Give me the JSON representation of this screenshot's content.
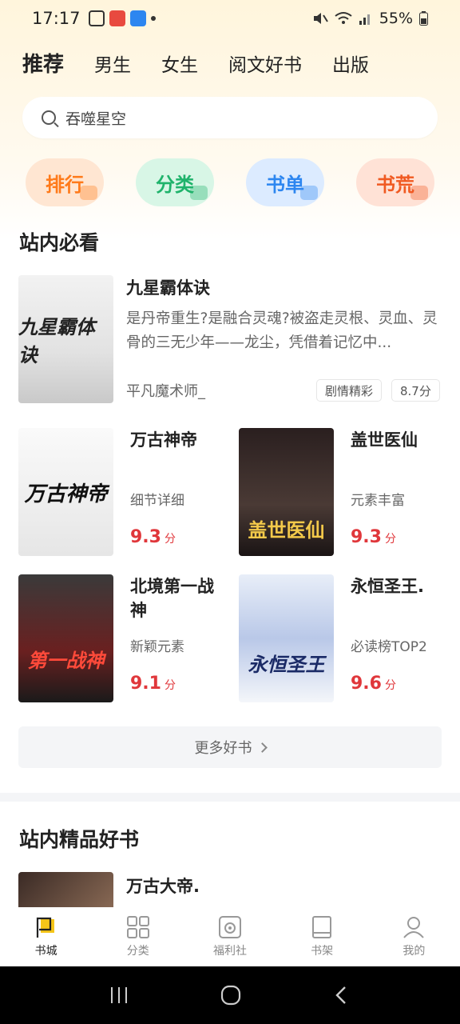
{
  "status_bar": {
    "time": "17:17",
    "battery": "55%"
  },
  "tabs": [
    {
      "label": "推荐",
      "active": true
    },
    {
      "label": "男生"
    },
    {
      "label": "女生"
    },
    {
      "label": "阅文好书"
    },
    {
      "label": "出版"
    }
  ],
  "search": {
    "placeholder": "吞噬星空"
  },
  "quick_buttons": [
    {
      "label": "排行",
      "bg": "#ffe6d2",
      "color": "#ff7a1a"
    },
    {
      "label": "分类",
      "bg": "#d8f6e6",
      "color": "#1fb36b"
    },
    {
      "label": "书单",
      "bg": "#dcebff",
      "color": "#2d86f0"
    },
    {
      "label": "书荒",
      "bg": "#ffe2d6",
      "color": "#f05a22"
    }
  ],
  "section1": {
    "title": "站内必看",
    "featured": {
      "name": "九星霸体诀",
      "cover_text": "九星霸体诀",
      "description": "是丹帝重生?是融合灵魂?被盗走灵根、灵血、灵骨的三无少年——龙尘，凭借着记忆中...",
      "author": "平凡魔术师_",
      "tag": "剧情精彩",
      "score": "8.7分"
    },
    "grid": [
      {
        "name": "万古神帝",
        "cover_text": "万古神帝",
        "sub": "细节详细",
        "score": "9.3",
        "unit": "分"
      },
      {
        "name": "盖世医仙",
        "cover_text": "盖世医仙",
        "sub": "元素丰富",
        "score": "9.3",
        "unit": "分"
      },
      {
        "name": "北境第一战神",
        "cover_text": "第一战神",
        "sub": "新颖元素",
        "score": "9.1",
        "unit": "分"
      },
      {
        "name": "永恒圣王.",
        "cover_text": "永恒圣王",
        "sub": "必读榜TOP2",
        "score": "9.6",
        "unit": "分"
      }
    ],
    "more": "更多好书"
  },
  "section2": {
    "title": "站内精品好书",
    "first_book": "万古大帝."
  },
  "bottom_nav": [
    {
      "label": "书城",
      "icon": "flag-icon",
      "active": true
    },
    {
      "label": "分类",
      "icon": "grid-icon"
    },
    {
      "label": "福利社",
      "icon": "gift-icon"
    },
    {
      "label": "书架",
      "icon": "bookshelf-icon"
    },
    {
      "label": "我的",
      "icon": "user-icon"
    }
  ],
  "colors": {
    "accent": "#e0373b",
    "nav_active_yellow": "#f5c518"
  }
}
